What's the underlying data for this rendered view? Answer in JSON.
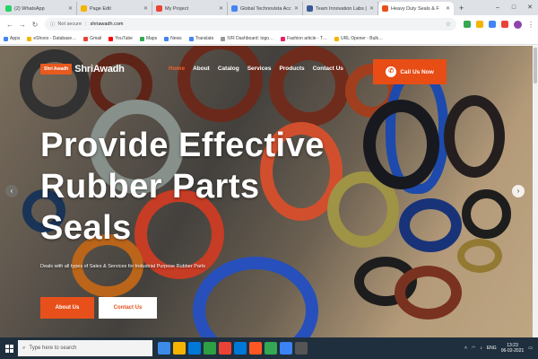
{
  "browser": {
    "tabs": [
      {
        "title": "(2) WhatsApp",
        "color": "#25d366",
        "active": false
      },
      {
        "title": "Page Edit",
        "color": "#f4b400",
        "active": false
      },
      {
        "title": "My Project",
        "color": "#ea4335",
        "active": false
      },
      {
        "title": "Global Technovista Acc",
        "color": "#4285f4",
        "active": false
      },
      {
        "title": "Team Innovation Labs |",
        "color": "#3b5998",
        "active": false
      },
      {
        "title": "Heavy Duty Seals & F",
        "color": "#e8501b",
        "active": true
      }
    ],
    "new_tab": "+",
    "address": {
      "security": "Not secure",
      "url": "shriawadh.com"
    },
    "bookmarks": [
      {
        "label": "Apps",
        "color": "#4285f4"
      },
      {
        "label": "eShoes - Database…",
        "color": "#f4b400"
      },
      {
        "label": "Gmail",
        "color": "#ea4335"
      },
      {
        "label": "YouTube",
        "color": "#ff0000"
      },
      {
        "label": "Maps",
        "color": "#34a853"
      },
      {
        "label": "News",
        "color": "#4285f4"
      },
      {
        "label": "Translate",
        "color": "#4285f4"
      },
      {
        "label": "IVR Dashboard: togo…",
        "color": "#999999"
      },
      {
        "label": "Fashion article - T…",
        "color": "#e91e63"
      },
      {
        "label": "URL Opener - Bulk…",
        "color": "#f4b400"
      }
    ]
  },
  "site": {
    "logo_badge": "Shri Awadh",
    "logo_name": "ShriAwadh",
    "nav": [
      {
        "label": "Home",
        "active": true
      },
      {
        "label": "About",
        "active": false
      },
      {
        "label": "Catalog",
        "active": false
      },
      {
        "label": "Services",
        "active": false
      },
      {
        "label": "Products",
        "active": false
      },
      {
        "label": "Contact Us",
        "active": false
      }
    ],
    "call_label": "Call Us Now",
    "headline_line1": "Provide Effective",
    "headline_line2": "Rubber Parts",
    "headline_line3": "Seals",
    "subline": "Deals with all types of Sales & Services for Industrial Purpose Rubber Parts",
    "about_btn": "About Us",
    "contact_btn": "Contact Us"
  },
  "taskbar": {
    "search_placeholder": "Type here to search",
    "time": "13:23",
    "date": "06-02-2021",
    "lang": "ENG",
    "apps": [
      "#3c8be8",
      "#f4b400",
      "#0078d7",
      "#2ea043",
      "#ea4335",
      "#0078d7",
      "#ff5722",
      "#34a853",
      "#3b82f6",
      "#555555"
    ]
  }
}
